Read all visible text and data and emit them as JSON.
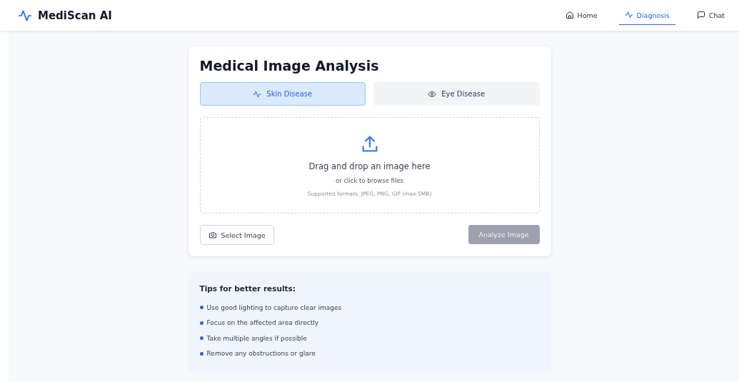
{
  "brand": {
    "name": "MediScan AI"
  },
  "nav": [
    {
      "label": "Home",
      "kind": "home",
      "selected": false
    },
    {
      "label": "Diagnosis",
      "kind": "pulse",
      "selected": true
    },
    {
      "label": "Chat",
      "kind": "chat",
      "selected": false
    }
  ],
  "card": {
    "title": "Medical Image Analysis",
    "modes": [
      {
        "label": "Skin Disease",
        "kind": "pulse",
        "selected": true
      },
      {
        "label": "Eye Disease",
        "kind": "eye",
        "selected": false
      }
    ],
    "dropzone": {
      "heading": "Drag and drop an image here",
      "subtext": "or click to browse files",
      "formats": "Supported formats: JPEG, PNG, GIF (max 5MB)"
    },
    "select_button": "Select Image",
    "analyze_button": {
      "label": "Analyze Image",
      "disabled": true
    }
  },
  "tips": {
    "title": "Tips for better results:",
    "items": [
      "Use good lighting to capture clear images",
      "Focus on the affected area directly",
      "Take multiple angles if possible",
      "Remove any obstructions or glare"
    ]
  }
}
